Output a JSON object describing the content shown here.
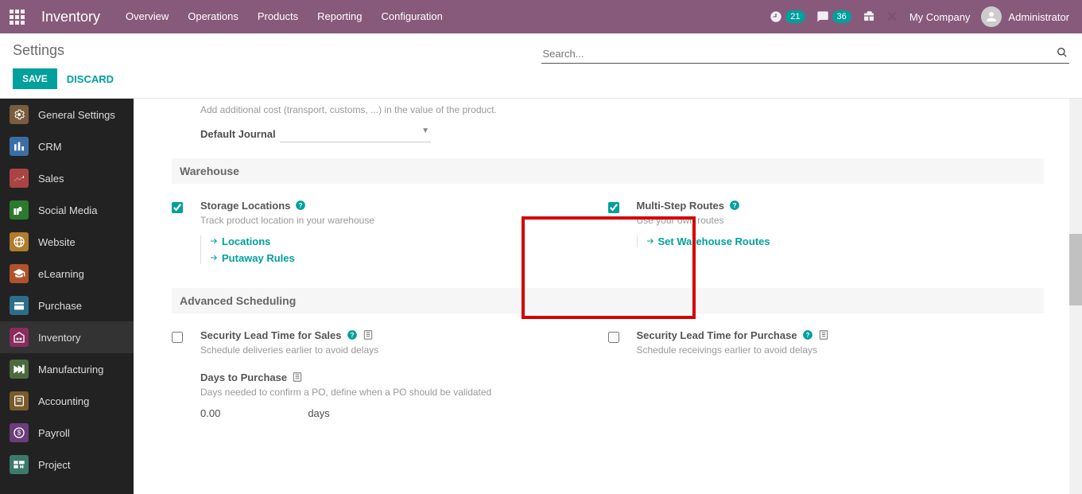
{
  "navbar": {
    "brand": "Inventory",
    "menu": [
      "Overview",
      "Operations",
      "Products",
      "Reporting",
      "Configuration"
    ],
    "clock_badge": "21",
    "chat_badge": "36",
    "company": "My Company",
    "user": "Administrator"
  },
  "cp": {
    "title": "Settings",
    "save": "SAVE",
    "discard": "DISCARD",
    "search_ph": "Search..."
  },
  "sidebar": {
    "items": [
      {
        "label": "General Settings",
        "color": "#7a5c3e"
      },
      {
        "label": "CRM",
        "color": "#3b6ea5"
      },
      {
        "label": "Sales",
        "color": "#a94442"
      },
      {
        "label": "Social Media",
        "color": "#2c7a2c"
      },
      {
        "label": "Website",
        "color": "#b07d2c"
      },
      {
        "label": "eLearning",
        "color": "#b0522c"
      },
      {
        "label": "Purchase",
        "color": "#2c6e8a"
      },
      {
        "label": "Inventory",
        "color": "#8a2c5c",
        "active": true
      },
      {
        "label": "Manufacturing",
        "color": "#4c6b3d"
      },
      {
        "label": "Accounting",
        "color": "#7a5c2c"
      },
      {
        "label": "Payroll",
        "color": "#6b3d7a"
      },
      {
        "label": "Project",
        "color": "#3d7a6b"
      }
    ]
  },
  "partial_top": {
    "desc": "Add additional cost (transport, customs, ...) in the value of the product.",
    "journal_label": "Default Journal"
  },
  "warehouse": {
    "head": "Warehouse",
    "storage": {
      "title": "Storage Locations",
      "desc": "Track product location in your warehouse",
      "links": [
        "Locations",
        "Putaway Rules"
      ],
      "checked": true
    },
    "routes": {
      "title": "Multi-Step Routes",
      "desc": "Use your own routes",
      "links": [
        "Set Warehouse Routes"
      ],
      "checked": true
    }
  },
  "adv": {
    "head": "Advanced Scheduling",
    "lead_sales": {
      "title": "Security Lead Time for Sales",
      "desc": "Schedule deliveries earlier to avoid delays",
      "checked": false
    },
    "lead_purchase": {
      "title": "Security Lead Time for Purchase",
      "desc": "Schedule receivings earlier to avoid delays",
      "checked": false
    },
    "days": {
      "title": "Days to Purchase",
      "desc": "Days needed to confirm a PO, define when a PO should be validated",
      "value": "0.00",
      "unit": "days"
    }
  }
}
